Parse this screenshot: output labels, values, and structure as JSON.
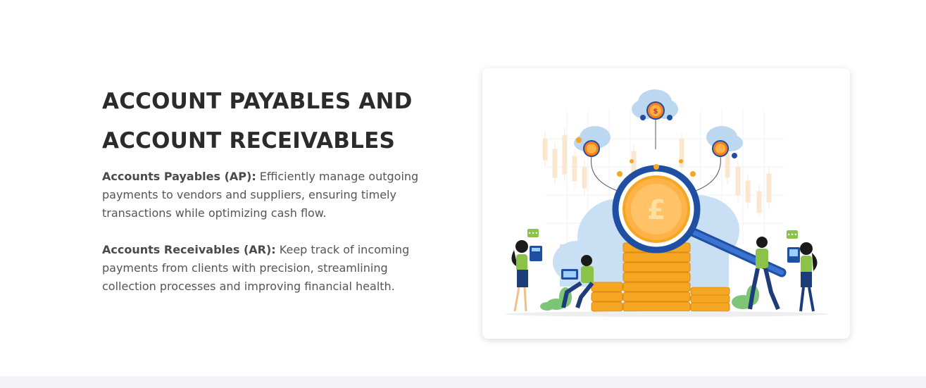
{
  "hero": {
    "heading_line1": "ACCOUNT PAYABLES AND",
    "heading_line2": "ACCOUNT RECEIVABLES",
    "payables_label": "Accounts Payables (AP):",
    "payables_text": " Efficiently manage outgoing payments to vendors and suppliers, ensuring timely transactions while optimizing cash flow.",
    "receivables_label": "Accounts Receivables (AR):",
    "receivables_text": " Keep track of incoming payments from clients with precision, streamlining collection processes and improving financial health."
  },
  "illustration": {
    "coin_symbol": "£",
    "cloud_coin_symbol": "$",
    "colors": {
      "coin": "#f5a623",
      "coin_light": "#ffd27a",
      "cloud": "#bcd7f0",
      "lens_ring": "#1e4fa3",
      "shirt": "#8bc34a",
      "pants": "#1f3c7a",
      "hair": "#1a1a1a",
      "chart_up": "#f7d9b0"
    }
  }
}
